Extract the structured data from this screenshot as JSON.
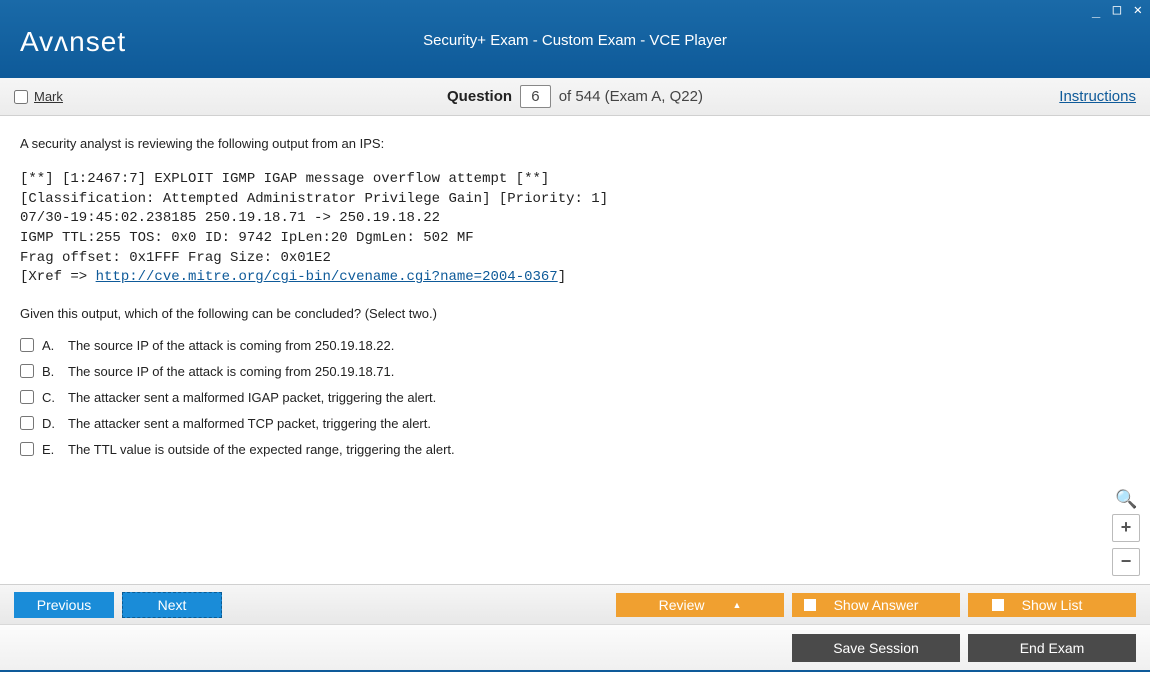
{
  "window": {
    "brand": "Avᴧnset",
    "title": "Security+ Exam - Custom Exam - VCE Player"
  },
  "subbar": {
    "mark_label": "Mark",
    "question_word": "Question",
    "question_number": "6",
    "of_text": "of 544 (Exam A, Q22)",
    "instructions": "Instructions"
  },
  "question": {
    "intro": "A security analyst is reviewing the following output from an IPS:",
    "code_lines": [
      "[**] [1:2467:7] EXPLOIT IGMP IGAP message overflow attempt [**]",
      "[Classification: Attempted Administrator Privilege Gain] [Priority: 1]",
      "07/30-19:45:02.238185 250.19.18.71 -> 250.19.18.22",
      "IGMP TTL:255 TOS: 0x0 ID: 9742 IpLen:20 DgmLen: 502 MF",
      "Frag offset: 0x1FFF Frag Size: 0x01E2"
    ],
    "xref_prefix": "[Xref => ",
    "xref_link": "http://cve.mitre.org/cgi-bin/cvename.cgi?name=2004-0367",
    "xref_suffix": "]",
    "prompt": "Given this output, which of the following can be concluded? (Select two.)",
    "options": [
      {
        "letter": "A.",
        "text": "The source IP of the attack is coming from 250.19.18.22."
      },
      {
        "letter": "B.",
        "text": "The source IP of the attack is coming from 250.19.18.71."
      },
      {
        "letter": "C.",
        "text": "The attacker sent a malformed IGAP packet, triggering the alert."
      },
      {
        "letter": "D.",
        "text": "The attacker sent a malformed TCP packet, triggering the alert."
      },
      {
        "letter": "E.",
        "text": "The TTL value is outside of the expected range, triggering the alert."
      }
    ]
  },
  "buttons": {
    "previous": "Previous",
    "next": "Next",
    "review": "Review",
    "show_answer": "Show Answer",
    "show_list": "Show List",
    "save_session": "Save Session",
    "end_exam": "End Exam"
  },
  "zoom": {
    "plus": "+",
    "minus": "−"
  }
}
